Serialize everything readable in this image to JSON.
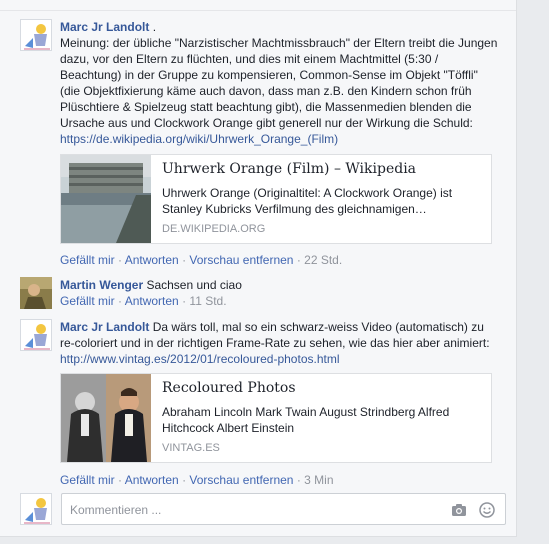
{
  "comments": [
    {
      "author": "Marc Jr Landolt",
      "author_suffix": " .",
      "text": "Meinung: der übliche \"Narzistischer Machtmissbrauch\" der Eltern treibt die Jungen dazu, vor den Eltern zu flüchten, und dies mit einem Machtmittel (5:30 / Beachtung) in der Gruppe zu kompensieren, Common-Sense im Objekt \"Töffli\" (die Objektfixierung käme auch davon, dass man z.B. den Kindern schon früh Plüschtiere & Spielzeug statt beachtung gibt), die Massenmedien blenden die Ursache aus und Clockwork Orange gibt generell nur der Wirkung die Schuld: ",
      "link": "https://de.wikipedia.org/wiki/Uhrwerk_Orange_(Film)",
      "preview": {
        "title": "Uhrwerk Orange (Film) – Wikipedia",
        "description": "Uhrwerk Orange (Originaltitel: A Clockwork Orange) ist Stanley Kubricks Verfilmung des gleichnamigen…",
        "domain": "DE.WIKIPEDIA.ORG"
      },
      "actions": {
        "like": "Gefällt mir",
        "reply": "Antworten",
        "remove_preview": "Vorschau entfernen",
        "time": "22 Std."
      }
    },
    {
      "author": "Martin Wenger",
      "text": " Sachsen und ciao",
      "actions": {
        "like": "Gefällt mir",
        "reply": "Antworten",
        "time": "11 Std."
      }
    },
    {
      "author": "Marc Jr Landolt",
      "text": " Da wärs toll, mal so ein schwarz-weiss Video (automatisch) zu re-coloriert und in der richtigen Frame-Rate zu sehen, wie das hier aber animiert: ",
      "link": "http://www.vintag.es/2012/01/recoloured-photos.html",
      "preview": {
        "title": "Recoloured Photos",
        "description": "Abraham Lincoln Mark Twain August Strindberg Alfred Hitchcock Albert Einstein",
        "domain": "VINTAG.ES"
      },
      "actions": {
        "like": "Gefällt mir",
        "reply": "Antworten",
        "remove_preview": "Vorschau entfernen",
        "time": "3 Min"
      }
    }
  ],
  "composer": {
    "placeholder": "Kommentieren ...",
    "camera_icon": "camera-icon",
    "emoji_icon": "emoji-icon"
  },
  "colors": {
    "link": "#365899",
    "action": "#4267b2",
    "muted": "#90949c",
    "background": "#f6f7f9"
  }
}
